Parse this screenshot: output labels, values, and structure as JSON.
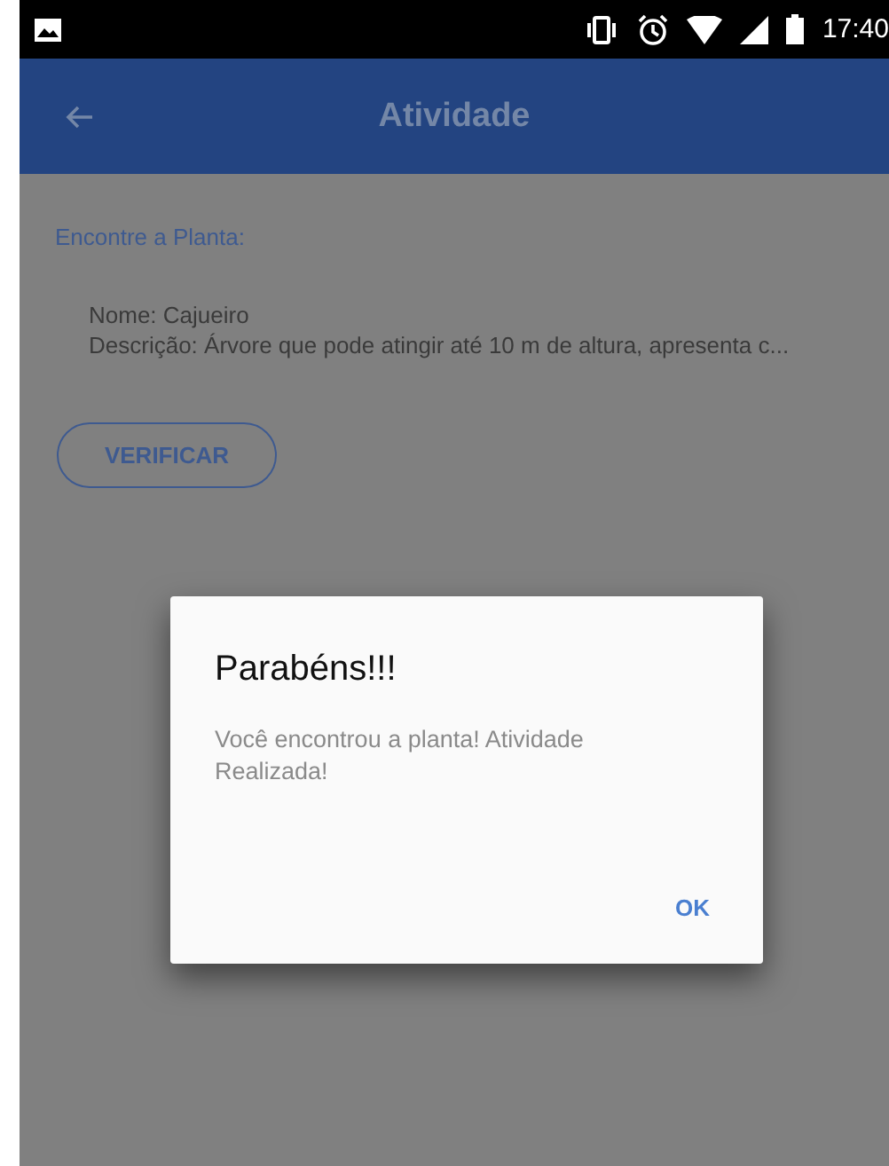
{
  "status_bar": {
    "time": "17:40"
  },
  "app_bar": {
    "title": "Atividade"
  },
  "content": {
    "heading": "Encontre a Planta:",
    "lines": [
      "Nome: Cajueiro",
      "Descrição: Árvore que pode atingir até 10 m de altura, apresenta c..."
    ],
    "button": "VERIFICAR"
  },
  "dialog": {
    "title": "Parabéns!!!",
    "message": "Você encontrou a planta! Atividade Realizada!",
    "buttons": [
      "OK"
    ]
  }
}
